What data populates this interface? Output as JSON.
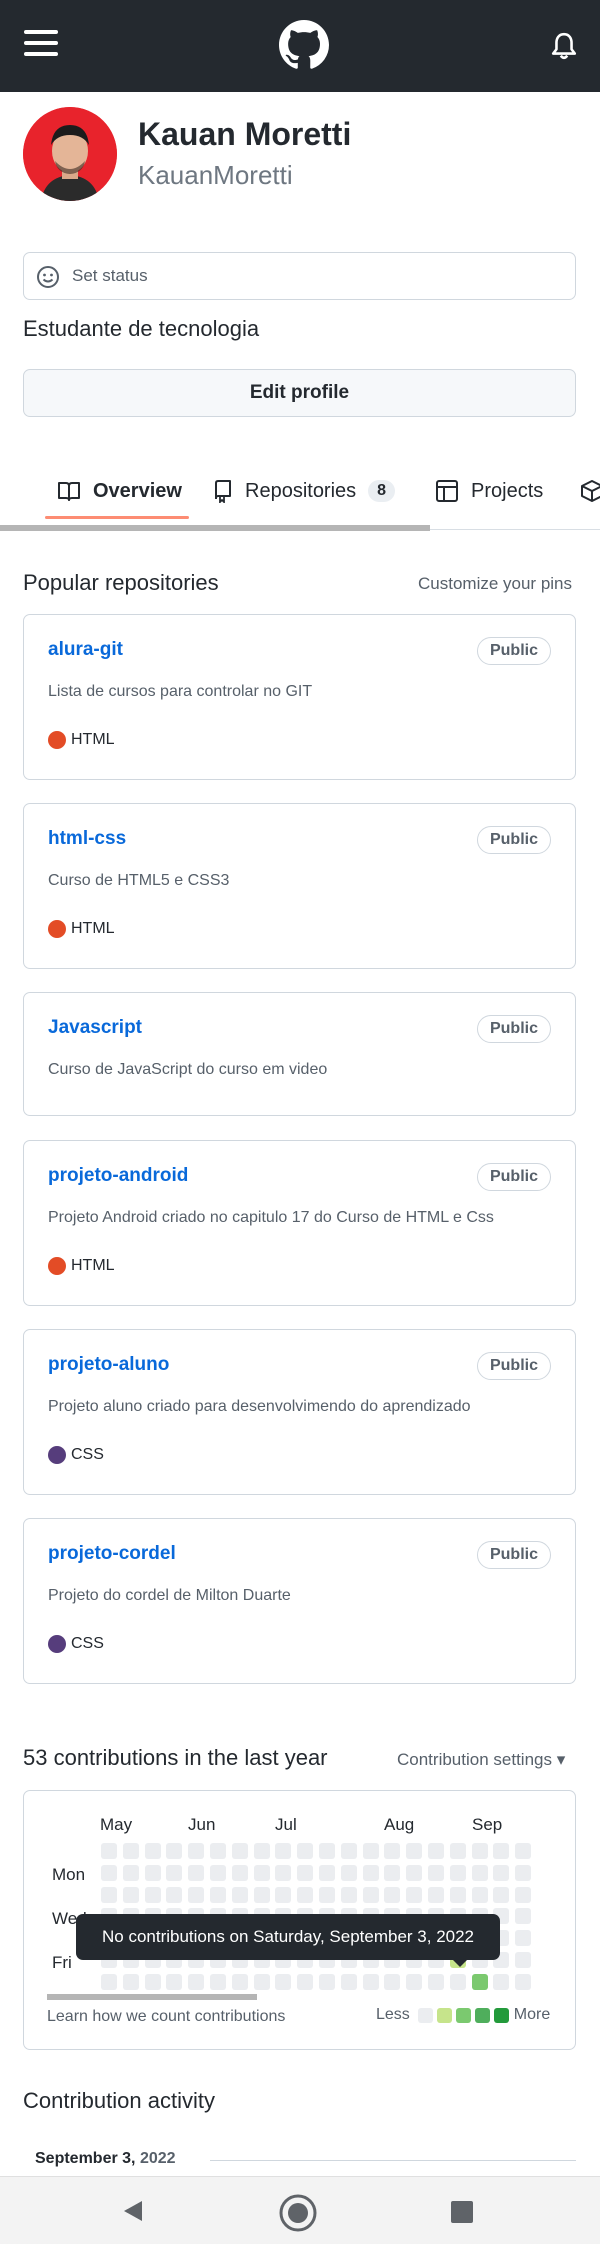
{
  "header": {
    "menu_icon": "hamburger-menu-icon",
    "logo_icon": "github-logo-icon",
    "bell_icon": "bell-icon"
  },
  "profile": {
    "name": "Kauan Moretti",
    "login": "KauanMoretti",
    "status_label": "Set status",
    "bio": "Estudante de tecnologia",
    "edit_button": "Edit profile"
  },
  "tabs": [
    {
      "label": "Overview",
      "icon": "book-icon",
      "active": true
    },
    {
      "label": "Repositories",
      "icon": "repo-icon",
      "count": "8"
    },
    {
      "label": "Projects",
      "icon": "table-icon"
    },
    {
      "label": "",
      "icon": "package-icon"
    }
  ],
  "popular": {
    "title": "Popular repositories",
    "customize": "Customize your pins",
    "repos": [
      {
        "name": "alura-git",
        "visibility": "Public",
        "description": "Lista de cursos para controlar no GIT",
        "language": "HTML",
        "lang_color": "#e34c26"
      },
      {
        "name": "html-css",
        "visibility": "Public",
        "description": "Curso de HTML5 e CSS3",
        "language": "HTML",
        "lang_color": "#e34c26"
      },
      {
        "name": "Javascript",
        "visibility": "Public",
        "description": "Curso de JavaScript do curso em video",
        "language": "",
        "lang_color": ""
      },
      {
        "name": "projeto-android",
        "visibility": "Public",
        "description": "Projeto Android criado no capitulo 17 do Curso de HTML e Css",
        "language": "HTML",
        "lang_color": "#e34c26"
      },
      {
        "name": "projeto-aluno",
        "visibility": "Public",
        "description": "Projeto aluno criado para desenvolvimendo do aprendizado",
        "language": "CSS",
        "lang_color": "#563d7c"
      },
      {
        "name": "projeto-cordel",
        "visibility": "Public",
        "description": "Projeto do cordel de Milton Duarte",
        "language": "CSS",
        "lang_color": "#563d7c"
      }
    ]
  },
  "contributions": {
    "title": "53 contributions in the last year",
    "settings": "Contribution settings ▾",
    "months": [
      "May",
      "Jun",
      "Jul",
      "Aug",
      "Sep"
    ],
    "days": [
      "Mon",
      "Wed",
      "Fri"
    ],
    "tooltip": "No contributions on Saturday, September 3, 2022",
    "learn": "Learn how we count contributions",
    "less": "Less",
    "more": "More",
    "level_colors": [
      "#ebedf0",
      "#c6e48b",
      "#7bc96f",
      "#4fae5c",
      "#239a3b"
    ]
  },
  "activity": {
    "title": "Contribution activity",
    "month": "September",
    "day": "3,",
    "year": "2022"
  },
  "system_nav": {
    "back_icon": "back-triangle-icon",
    "home_icon": "home-circle-icon",
    "recent_icon": "recent-apps-square-icon"
  }
}
